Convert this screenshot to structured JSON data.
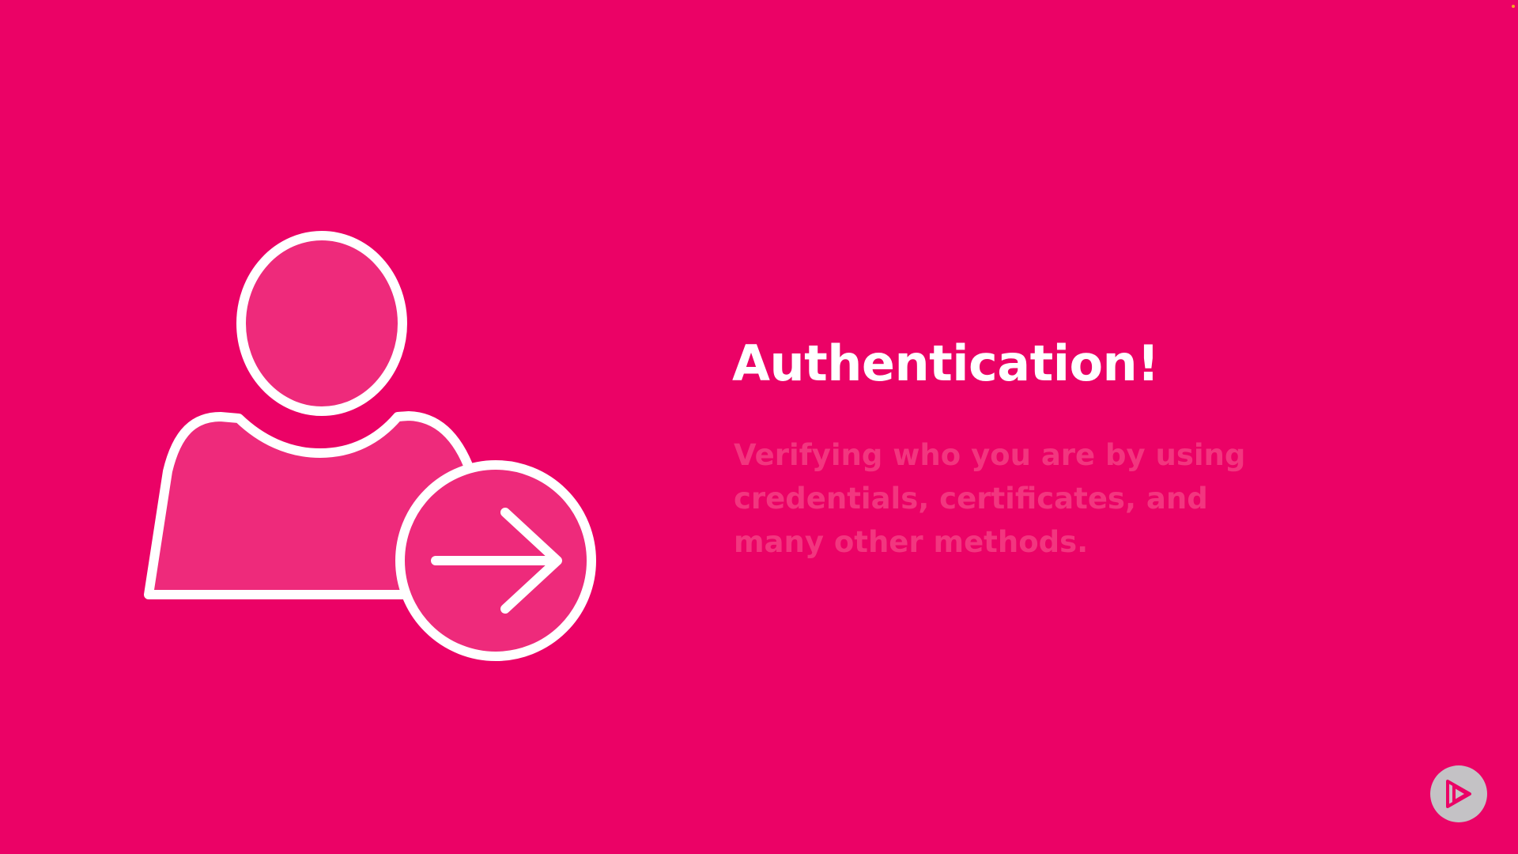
{
  "slide": {
    "background_color": "#EB0266",
    "title": "Authentication!",
    "description": "Verifying who you are by using credentials, certificates, and many other methods.",
    "title_color": "#FFFFFF",
    "description_color": "#F2367F"
  },
  "illustration": {
    "icon": "user-login-icon",
    "stroke_color": "#FFFFFF",
    "fill_color": "#EE2A7B"
  },
  "player": {
    "icon": "play-logo-icon",
    "button_color": "#C4C2C5",
    "icon_color": "#EB0266"
  }
}
